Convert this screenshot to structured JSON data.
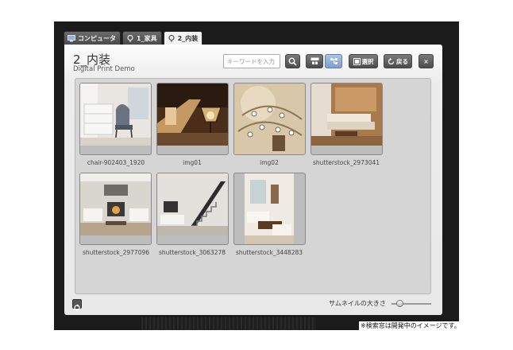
{
  "tabs": [
    {
      "label": "コンピュータ",
      "icon": "computer-icon",
      "active": false
    },
    {
      "label": "1_家具",
      "icon": "pin-icon",
      "active": false
    },
    {
      "label": "2_内装",
      "icon": "pin-icon",
      "active": true
    }
  ],
  "header": {
    "title": "2_内装",
    "subtitle": "Digital Print Demo"
  },
  "search": {
    "placeholder": "キーワードを入力"
  },
  "toolbar": {
    "select_label": "選択",
    "back_label": "戻る",
    "close_label": "×"
  },
  "thumbnails": [
    {
      "caption": "chair-902403_1920"
    },
    {
      "caption": "img01"
    },
    {
      "caption": "img02"
    },
    {
      "caption": "shutterstock_2973041"
    },
    {
      "caption": "shutterstock_2977096"
    },
    {
      "caption": "shutterstock_3063278"
    },
    {
      "caption": "shutterstock_3448283"
    }
  ],
  "footer": {
    "thumbnail_size_label": "サムネイルの大きさ",
    "thumbnail_size_level": 0.2
  },
  "note": "※検索窓は開発中のイメージです。",
  "colors": {
    "backdrop": "#1b1b1b",
    "panel": "#e8e8e8",
    "grid_area": "#d5d5d5",
    "active_view_button": "#7e9fcd"
  }
}
